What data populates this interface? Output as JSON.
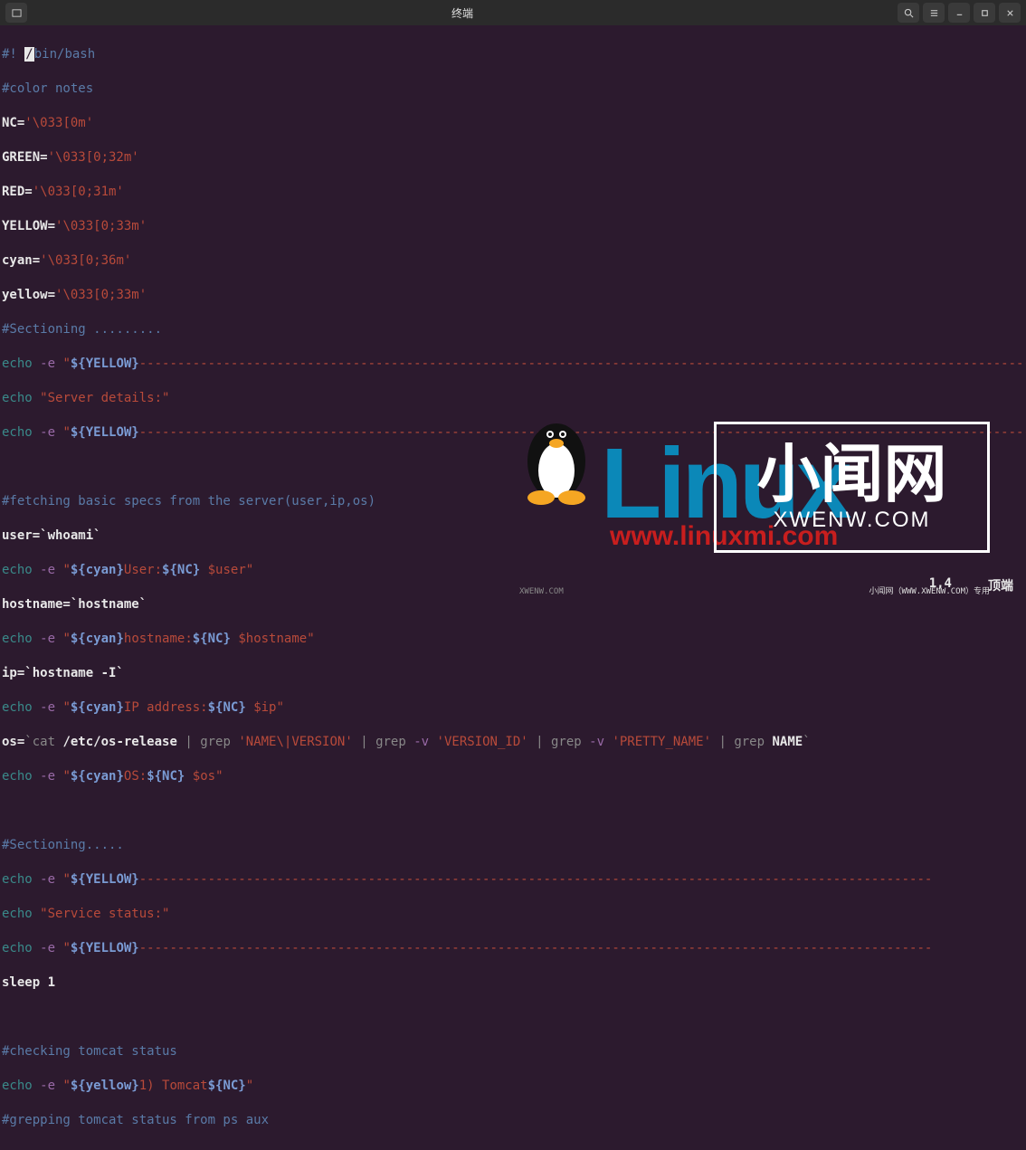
{
  "window": {
    "title": "终端"
  },
  "script": {
    "shebang_prefix": "#! ",
    "shebang_cursor": "/",
    "shebang_rest": "bin/bash",
    "comment_color": "#color notes",
    "nc_var": "NC=",
    "nc_val": "'\\033[0m'",
    "green_var": "GREEN=",
    "green_val": "'\\033[0;32m'",
    "red_var": "RED=",
    "red_val": "'\\033[0;31m'",
    "yellow_var": "YELLOW=",
    "yellow_val": "'\\033[0;33m'",
    "cyan_var": "cyan=",
    "cyan_val": "'\\033[0;36m'",
    "yellow2_var": "yellow=",
    "yellow2_val": "'\\033[0;33m'",
    "section1": "#Sectioning .........",
    "echo": "echo",
    "flag_e": " -e ",
    "yellow_tok": "${YELLOW}",
    "nc_tok": "${NC}",
    "cyan_tok": "${cyan}",
    "yellow_lc_tok": "${yellow}",
    "server_details": "\"Server details:\"",
    "fetch_comment": "#fetching basic specs from the server(user,ip,os)",
    "user_line": "user=`whoami`",
    "user_label": "User:",
    "user_var": " $user",
    "hostname_line": "hostname=`hostname`",
    "hostname_label": "hostname:",
    "hostname_var": " $hostname",
    "ip_line": "ip=`hostname -I`",
    "ip_label": "IP address:",
    "ip_var": " $ip",
    "os_prefix": "os=",
    "os_cat": "`cat ",
    "os_path": "/etc/os-release",
    "os_pipe": " | ",
    "grep": "grep ",
    "name_version": "'NAME\\|VERSION'",
    "flag_v": "-v ",
    "version_id": "'VERSION_ID'",
    "pretty_name": "'PRETTY_NAME'",
    "name_word": "NAME",
    "backtick": "`",
    "os_label": "OS:",
    "os_var": " $os",
    "section2": "#Sectioning.....",
    "service_status": "\"Service status:\"",
    "sleep_line": "sleep 1",
    "tomcat_comment": "#checking tomcat status",
    "tomcat_num": "1) Tomcat",
    "grep_comment": "#grepping tomcat status from ps aux",
    "dashes_long": "---------------------------------------------------------------------------------------------------------------------------------",
    "dashes_short": "--------------------------------------------------------------------------------------------------------",
    "q1": "\"",
    "q2": "\""
  },
  "status": {
    "pos": "1,4",
    "label": "顶端"
  },
  "watermark": {
    "linux": "Linux",
    "url": "www.linuxmi.com",
    "cn": "小闻网",
    "en": "XWENW.COM",
    "small": "小闻网（WWW.XWENW.COM）专用",
    "small2": "XWENW.COM"
  }
}
